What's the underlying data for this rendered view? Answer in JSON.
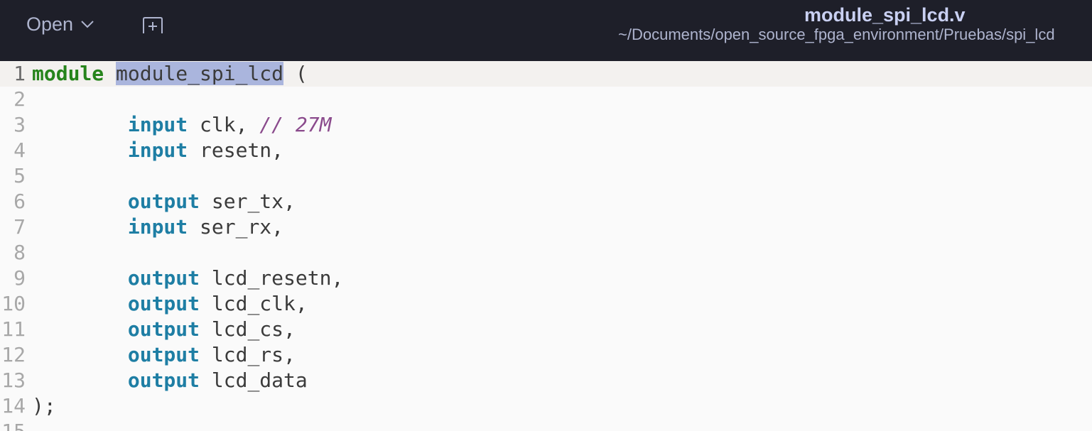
{
  "header": {
    "open_label": "Open",
    "title": "module_spi_lcd.v",
    "path": "~/Documents/open_source_fpga_environment/Pruebas/spi_lcd"
  },
  "icons": {
    "open_dropdown": "chevron-down-icon",
    "new_tab": "new-tab-icon"
  },
  "colors": {
    "header_bg": "#1e1f29",
    "editor_bg": "#fafafa",
    "current_line_bg": "#f3f1ef",
    "keyword_module": "#26841c",
    "keyword_io": "#1e7ea4",
    "comment": "#8a4a8c",
    "selection": "#aab5dd"
  },
  "editor": {
    "lines": [
      {
        "num": "1",
        "indent": "",
        "kw": "module",
        "kw_type": "module",
        "sel": "module_spi_lcd",
        "rest": " (",
        "comment": ""
      },
      {
        "num": "2",
        "indent": "",
        "kw": "",
        "kw_type": "",
        "sel": "",
        "rest": "",
        "comment": ""
      },
      {
        "num": "3",
        "indent": "        ",
        "kw": "input",
        "kw_type": "io",
        "sel": "",
        "rest": " clk, ",
        "comment": "// 27M"
      },
      {
        "num": "4",
        "indent": "        ",
        "kw": "input",
        "kw_type": "io",
        "sel": "",
        "rest": " resetn,",
        "comment": ""
      },
      {
        "num": "5",
        "indent": "",
        "kw": "",
        "kw_type": "",
        "sel": "",
        "rest": "",
        "comment": ""
      },
      {
        "num": "6",
        "indent": "        ",
        "kw": "output",
        "kw_type": "io",
        "sel": "",
        "rest": " ser_tx,",
        "comment": ""
      },
      {
        "num": "7",
        "indent": "        ",
        "kw": "input",
        "kw_type": "io",
        "sel": "",
        "rest": " ser_rx,",
        "comment": ""
      },
      {
        "num": "8",
        "indent": "",
        "kw": "",
        "kw_type": "",
        "sel": "",
        "rest": "",
        "comment": ""
      },
      {
        "num": "9",
        "indent": "        ",
        "kw": "output",
        "kw_type": "io",
        "sel": "",
        "rest": " lcd_resetn,",
        "comment": ""
      },
      {
        "num": "10",
        "indent": "        ",
        "kw": "output",
        "kw_type": "io",
        "sel": "",
        "rest": " lcd_clk,",
        "comment": ""
      },
      {
        "num": "11",
        "indent": "        ",
        "kw": "output",
        "kw_type": "io",
        "sel": "",
        "rest": " lcd_cs,",
        "comment": ""
      },
      {
        "num": "12",
        "indent": "        ",
        "kw": "output",
        "kw_type": "io",
        "sel": "",
        "rest": " lcd_rs,",
        "comment": ""
      },
      {
        "num": "13",
        "indent": "        ",
        "kw": "output",
        "kw_type": "io",
        "sel": "",
        "rest": " lcd_data",
        "comment": ""
      },
      {
        "num": "14",
        "indent": "",
        "kw": "",
        "kw_type": "",
        "sel": "",
        "rest": ");",
        "comment": ""
      },
      {
        "num": "15",
        "indent": "",
        "kw": "",
        "kw_type": "",
        "sel": "",
        "rest": "",
        "comment": ""
      }
    ]
  }
}
